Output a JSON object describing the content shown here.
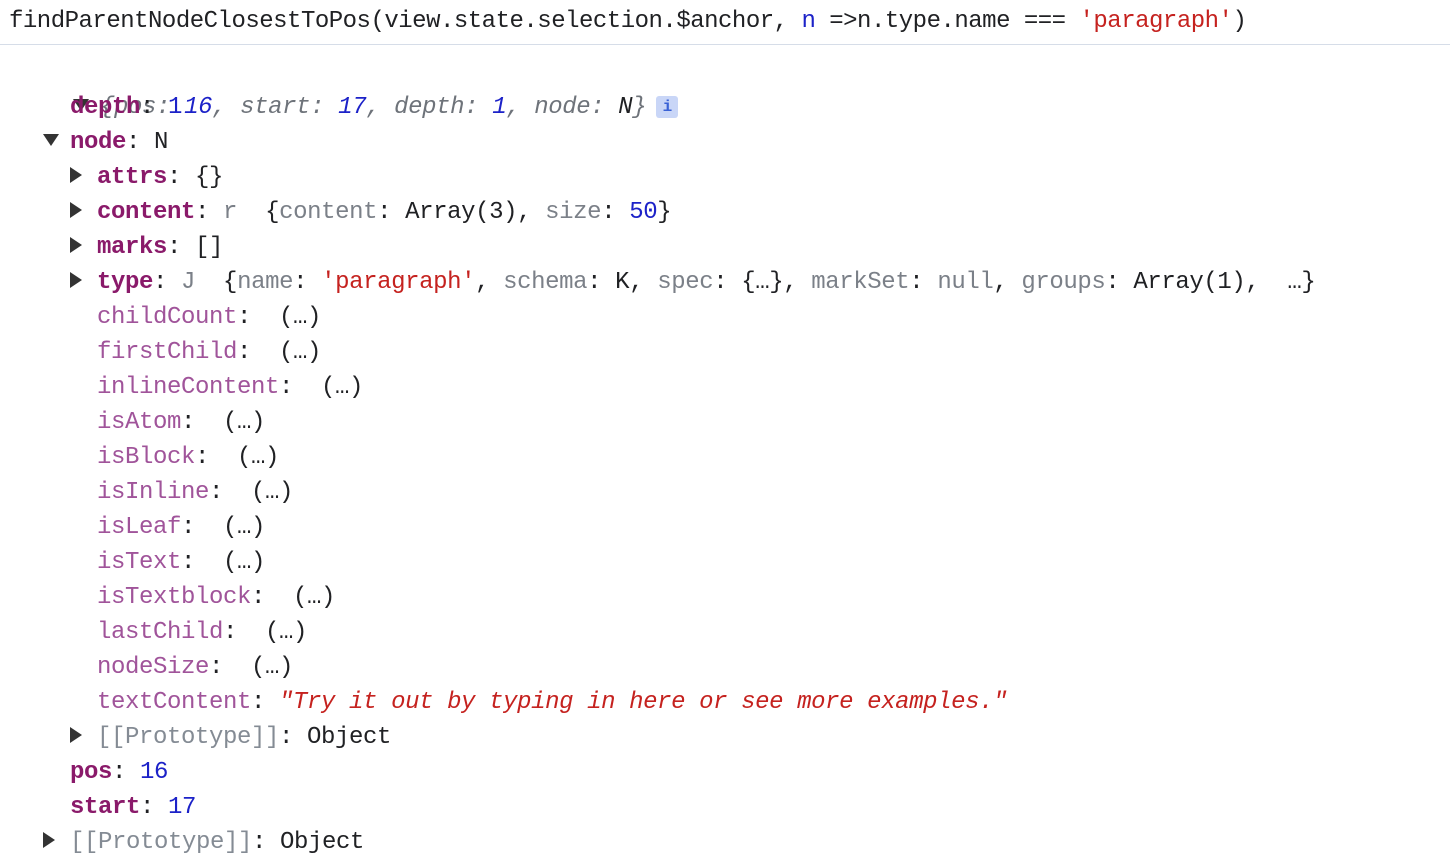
{
  "command": {
    "prefix": "findParentNodeClosestToPos(view.state.selection.$anchor, ",
    "param": "n",
    "arrow": " =>n.type.name === ",
    "str": "'paragraph'",
    "close": ")"
  },
  "summary": {
    "open": "{",
    "k1": "pos",
    "v1": "16",
    "k2": "start",
    "v2": "17",
    "k3": "depth",
    "v3": "1",
    "k4": "node",
    "v4": "N",
    "close": "}",
    "info": "i"
  },
  "props": {
    "depth_key": "depth",
    "depth_val": "1",
    "node_key": "node",
    "node_val": "N",
    "attrs_key": "attrs",
    "attrs_val": "{}",
    "content_key": "content",
    "content_type": "r",
    "content_preview_k1": "content",
    "content_preview_v1": "Array(3)",
    "content_preview_k2": "size",
    "content_preview_v2": "50",
    "marks_key": "marks",
    "marks_val": "[]",
    "type_key": "type",
    "type_type": "J",
    "type_k1": "name",
    "type_v1": "'paragraph'",
    "type_k2": "schema",
    "type_v2": "K",
    "type_k3": "spec",
    "type_v3": "{…}",
    "type_k4": "markSet",
    "type_v4": "null",
    "type_k5": "groups",
    "type_v5": "Array(1)",
    "type_more": "…}",
    "getters": [
      {
        "key": "childCount",
        "val": "(…)"
      },
      {
        "key": "firstChild",
        "val": "(…)"
      },
      {
        "key": "inlineContent",
        "val": "(…)"
      },
      {
        "key": "isAtom",
        "val": "(…)"
      },
      {
        "key": "isBlock",
        "val": "(…)"
      },
      {
        "key": "isInline",
        "val": "(…)"
      },
      {
        "key": "isLeaf",
        "val": "(…)"
      },
      {
        "key": "isText",
        "val": "(…)"
      },
      {
        "key": "isTextblock",
        "val": "(…)"
      },
      {
        "key": "lastChild",
        "val": "(…)"
      },
      {
        "key": "nodeSize",
        "val": "(…)"
      }
    ],
    "textContent_key": "textContent",
    "textContent_val": "\"Try it out by typing in here or see more examples.\"",
    "proto_key": "[[Prototype]]",
    "proto_val": "Object",
    "pos_key": "pos",
    "pos_val": "16",
    "start_key": "start",
    "start_val": "17",
    "proto2_key": "[[Prototype]]",
    "proto2_val": "Object"
  }
}
